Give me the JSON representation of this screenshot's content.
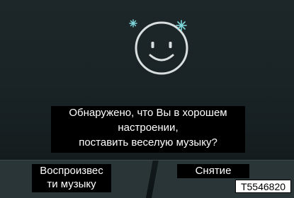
{
  "dialog": {
    "message_lines": [
      "Обнаружено, что Вы в хорошем",
      "настроении,",
      "поставить веселую музыку?"
    ]
  },
  "buttons": {
    "play_music_lines": [
      "Воспроизвес",
      "ти музыку"
    ],
    "cancel": "Снятие"
  },
  "figure_code": "T5546820",
  "icons": {
    "smiley": "smiley-face-icon",
    "sparkle_left": "sparkle-icon",
    "sparkle_right": "sparkle-icon"
  },
  "colors": {
    "background": "#1a2427",
    "accent_cyan": "#7fd9dc",
    "text": "#ffffff"
  }
}
